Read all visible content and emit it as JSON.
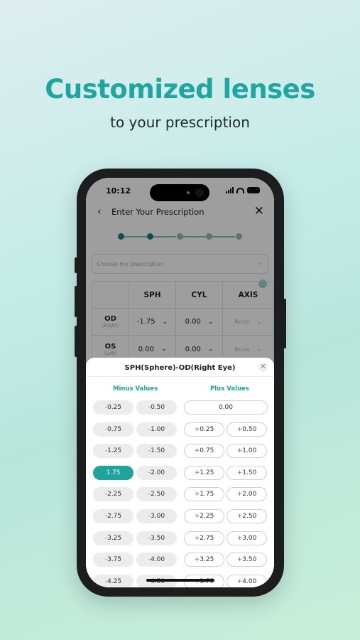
{
  "headline": "Customized lenses",
  "subhead": "to your prescription",
  "status_bar": {
    "time": "10:12"
  },
  "nav": {
    "title": "Enter Your Prescription"
  },
  "choose_placeholder": "Choose my prescription",
  "grid": {
    "headers": [
      "SPH",
      "CYL",
      "AXIS"
    ],
    "rows": [
      {
        "eye": "OD",
        "sub": "(Right)",
        "sph": "-1.75",
        "cyl": "0.00",
        "axis": "None"
      },
      {
        "eye": "OS",
        "sub": "(Left)",
        "sph": "0.00",
        "cyl": "0.00",
        "axis": "None"
      }
    ]
  },
  "sheet": {
    "title": "SPH(Sphere)-OD(Right Eye)",
    "minus_header": "Minus Values",
    "plus_header": "Plus Values",
    "zero_value": "0.00",
    "minus_rows": [
      [
        "-0.25",
        "-0.50"
      ],
      [
        "-0.75",
        "-1.00"
      ],
      [
        "-1.25",
        "-1.50"
      ],
      [
        "-1.75",
        "-2.00"
      ],
      [
        "-2.25",
        "-2.50"
      ],
      [
        "-2.75",
        "-3.00"
      ],
      [
        "-3.25",
        "-3.50"
      ],
      [
        "-3.75",
        "-4.00"
      ],
      [
        "-4.25",
        "-4.50"
      ]
    ],
    "plus_rows": [
      [
        "+0.25",
        "+0.50"
      ],
      [
        "+0.75",
        "+1.00"
      ],
      [
        "+1.25",
        "+1.50"
      ],
      [
        "+1.75",
        "+2.00"
      ],
      [
        "+2.25",
        "+2.50"
      ],
      [
        "+2.75",
        "+3.00"
      ],
      [
        "+3.25",
        "+3.50"
      ],
      [
        "+3.75",
        "+4.00"
      ]
    ],
    "selected": "-1.75"
  },
  "colors": {
    "accent": "#1ea39d",
    "minus_sign": "#3a80c2",
    "plus_sign": "#e04848"
  }
}
